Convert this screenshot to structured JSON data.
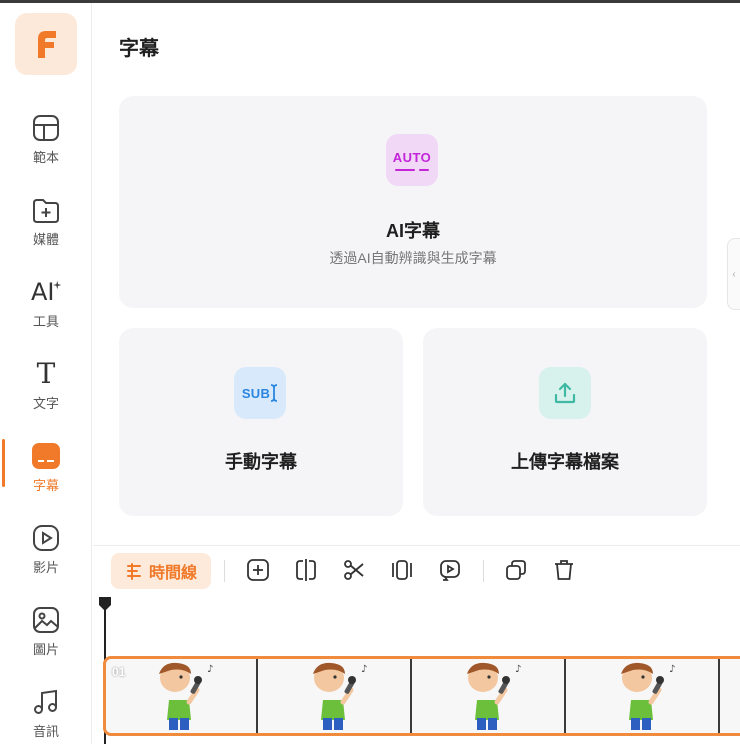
{
  "panel": {
    "title": "字幕"
  },
  "sidebar": {
    "items": [
      {
        "label": "範本",
        "icon": "template-icon"
      },
      {
        "label": "媒體",
        "icon": "media-folder-icon"
      },
      {
        "label": "工具",
        "icon": "ai-tools-icon",
        "icon_text": "AI"
      },
      {
        "label": "文字",
        "icon": "text-icon",
        "icon_text": "T"
      },
      {
        "label": "字幕",
        "icon": "subtitle-icon",
        "active": true
      },
      {
        "label": "影片",
        "icon": "video-play-icon"
      },
      {
        "label": "圖片",
        "icon": "image-icon"
      },
      {
        "label": "音訊",
        "icon": "music-note-icon"
      }
    ]
  },
  "cards": {
    "ai": {
      "badge": "AUTO",
      "title": "AI字幕",
      "subtitle": "透過AI自動辨識與生成字幕"
    },
    "manual": {
      "badge": "SUB",
      "title": "手動字幕"
    },
    "upload": {
      "title": "上傳字幕檔案"
    }
  },
  "toolbar": {
    "timeline_label": "時間線",
    "tools": [
      "add-icon",
      "split-icon",
      "scissors-icon",
      "freeze-frame-icon",
      "replace-icon",
      "duplicate-icon",
      "delete-icon"
    ]
  },
  "timeline": {
    "clip_index": "01"
  },
  "colors": {
    "accent": "#f07a2a",
    "auto_badge": "#c325d8",
    "sub_badge": "#2a86e0",
    "upload_badge": "#3fb9a4"
  }
}
